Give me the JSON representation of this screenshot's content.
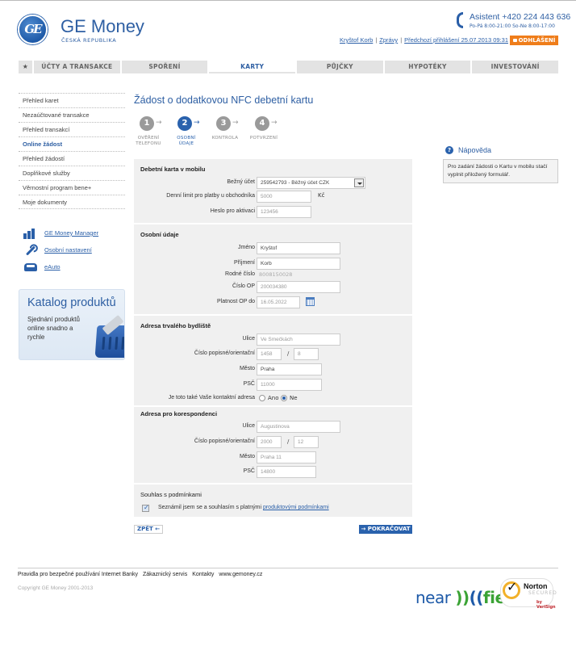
{
  "header": {
    "brand": "GE Money",
    "brand_sub": "ČESKÁ REPUBLIKA",
    "logo_text": "GE",
    "assistant": "Asistent +420 224 443 636",
    "hours": "Po-Pá 8:00-21:00 So-Ne 8:00-17:00",
    "user_name": "Kryštof Korb",
    "messages": "Zprávy",
    "last_login": "Předchozí přihlášení 25.07.2013 09:31",
    "separator": "|",
    "logout": "ODHLÁŠENÍ",
    "accent_color": "#ef7d1a"
  },
  "nav": {
    "home_icon": "★",
    "items": [
      {
        "label": "ÚČTY A TRANSAKCE",
        "active": false
      },
      {
        "label": "SPOŘENÍ",
        "active": false
      },
      {
        "label": "KARTY",
        "active": true
      },
      {
        "label": "PŮJČKY",
        "active": false
      },
      {
        "label": "HYPOTÉKY",
        "active": false
      },
      {
        "label": "INVESTOVÁNÍ",
        "active": false
      }
    ]
  },
  "sidebar": {
    "items": [
      {
        "label": "Přehled karet",
        "active": false
      },
      {
        "label": "Nezaúčtované transakce",
        "active": false
      },
      {
        "label": "Přehled transakcí",
        "active": false
      },
      {
        "label": "Online žádost",
        "active": true
      },
      {
        "label": "Přehled žádostí",
        "active": false
      },
      {
        "label": "Doplňkové služby",
        "active": false
      },
      {
        "label": "Věrnostní program bene+",
        "active": false
      },
      {
        "label": "Moje dokumenty",
        "active": false
      }
    ],
    "tools": [
      {
        "label": "GE Money Manager",
        "icon": "bar-chart-icon"
      },
      {
        "label": "Osobní nastavení",
        "icon": "wrench-icon"
      },
      {
        "label": "eAuto",
        "icon": "car-icon"
      }
    ],
    "katalog": {
      "title": "Katalog produktů",
      "subtitle": "Sjednání produktů online snadno a rychle"
    }
  },
  "main": {
    "title": "Žádost o dodatkovou NFC debetní kartu",
    "steps": [
      {
        "num": "1",
        "label": "OVĚŘENÍ TELEFONU",
        "active": false
      },
      {
        "num": "2",
        "label": "OSOBNÍ ÚDAJE",
        "active": true
      },
      {
        "num": "3",
        "label": "KONTROLA",
        "active": false
      },
      {
        "num": "4",
        "label": "POTVRZENÍ",
        "active": false
      }
    ],
    "step_arrow": "→",
    "card": {
      "title": "Debetní karta v mobilu",
      "account_label": "Bežný účet",
      "account_value": "259542793 - Běžný účet CZK",
      "limit_label": "Denní limit pro platby u obchodníka",
      "limit_value": "5000",
      "limit_unit": "Kč",
      "password_label": "Heslo pro aktivaci",
      "password_value": "123456"
    },
    "personal": {
      "title": "Osobní údaje",
      "first_name_label": "Jméno",
      "first_name": "Kryštof",
      "last_name_label": "Příjmení",
      "last_name": "Korb",
      "birth_no_label": "Rodné číslo",
      "birth_no": "8008150028",
      "id_no_label": "Číslo OP",
      "id_no": "200034380",
      "id_valid_label": "Platnost OP do",
      "id_valid": "16.05.2022"
    },
    "permanent": {
      "title": "Adresa trvalého bydliště",
      "street_label": "Ulice",
      "street": "Ve Smečkách",
      "number_label": "Číslo popisné/orientační",
      "number1": "1458",
      "number2": "8",
      "slash": "/",
      "city_label": "Město",
      "city": "Praha",
      "zip_label": "PSČ",
      "zip": "11000",
      "contact_q": "Je toto také Vaše kontaktní adresa",
      "yes": "Ano",
      "no": "Ne",
      "selected": "Ne"
    },
    "correspondence": {
      "title": "Adresa pro korespondenci",
      "street_label": "Ulice",
      "street": "Augustinova",
      "number_label": "Číslo popisné/orientační",
      "number1": "2000",
      "number2": "12",
      "slash": "/",
      "city_label": "Město",
      "city": "Praha 11",
      "zip_label": "PSČ",
      "zip": "14800"
    },
    "consent": {
      "title": "Souhlas s podmínkami",
      "text": "Seznámil jsem se a souhlasím s platnými",
      "link": "produktovými podmínkami",
      "checked": true
    },
    "back": "ZPĚT ←",
    "next": "→ POKRAČOVAT",
    "primary_color": "#2a62ad"
  },
  "help": {
    "icon": "?",
    "title": "Nápověda",
    "text": "Pro zadání žádosti o Kartu v mobilu stačí vyplnit přiložený formulář."
  },
  "footer": {
    "links": [
      "Pravidla pro bezpečné používání Internet Banky",
      "Zákaznický servis",
      "Kontakty",
      "www.gemoney.cz"
    ],
    "copyright": "Copyright GE Money 2001-2013",
    "nfc_left": "near",
    "nfc_mid1": "))",
    "nfc_mid2": "((",
    "nfc_right": "field",
    "norton": "Norton",
    "norton_secured": "SECURED",
    "norton_vs": "by VeriSign"
  }
}
